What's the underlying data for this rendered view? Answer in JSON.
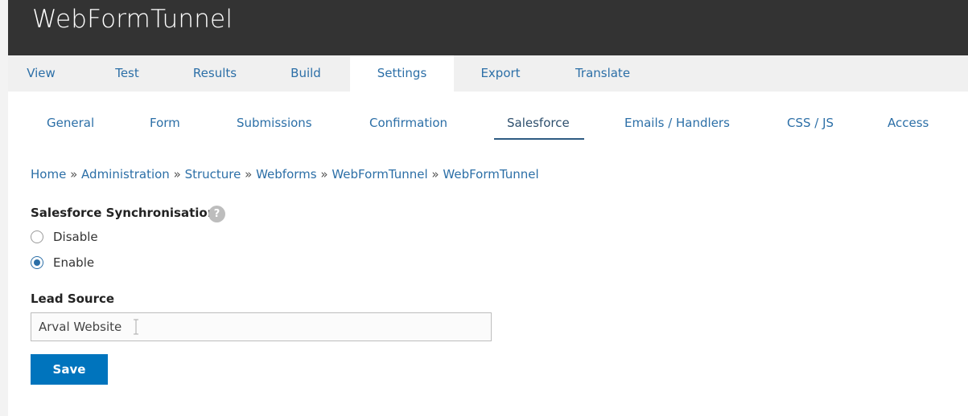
{
  "app": {
    "title": "WebFormTunnel"
  },
  "primary_tabs": [
    {
      "label": "View"
    },
    {
      "label": "Test"
    },
    {
      "label": "Results"
    },
    {
      "label": "Build"
    },
    {
      "label": "Settings",
      "active": true
    },
    {
      "label": "Export"
    },
    {
      "label": "Translate"
    }
  ],
  "secondary_tabs": [
    {
      "label": "General"
    },
    {
      "label": "Form"
    },
    {
      "label": "Submissions"
    },
    {
      "label": "Confirmation"
    },
    {
      "label": "Salesforce",
      "active": true
    },
    {
      "label": "Emails / Handlers"
    },
    {
      "label": "CSS / JS"
    },
    {
      "label": "Access"
    }
  ],
  "breadcrumb": {
    "items": [
      "Home",
      "Administration",
      "Structure",
      "Webforms",
      "WebFormTunnel",
      "WebFormTunnel"
    ],
    "separator": "»"
  },
  "sync": {
    "label": "Salesforce Synchronisation",
    "help_icon": "?",
    "options": [
      {
        "label": "Disable",
        "checked": false
      },
      {
        "label": "Enable",
        "checked": true
      }
    ]
  },
  "lead_source": {
    "label": "Lead Source",
    "value": "Arval Website"
  },
  "actions": {
    "save_label": "Save"
  },
  "colors": {
    "header_bg": "#333333",
    "link": "#2c6fa7",
    "button_bg": "#0074bd",
    "tab_bar_bg": "#f0f0f0"
  }
}
